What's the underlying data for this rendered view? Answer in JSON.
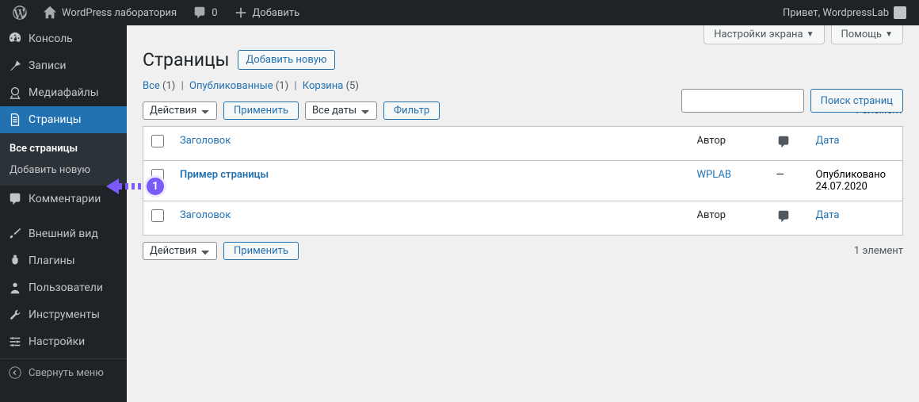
{
  "adminbar": {
    "site_name": "WordPress лаборатория",
    "comments_count": "0",
    "add_new": "Добавить",
    "greeting": "Привет, WordpressLab"
  },
  "sidebar": {
    "items": [
      {
        "label": "Консоль"
      },
      {
        "label": "Записи"
      },
      {
        "label": "Медиафайлы"
      },
      {
        "label": "Страницы"
      },
      {
        "label": "Комментарии"
      },
      {
        "label": "Внешний вид"
      },
      {
        "label": "Плагины"
      },
      {
        "label": "Пользователи"
      },
      {
        "label": "Инструменты"
      },
      {
        "label": "Настройки"
      }
    ],
    "submenu": [
      {
        "label": "Все страницы"
      },
      {
        "label": "Добавить новую"
      }
    ],
    "collapse": "Свернуть меню"
  },
  "screen_options": {
    "settings": "Настройки экрана",
    "help": "Помощь"
  },
  "header": {
    "title": "Страницы",
    "add_new": "Добавить новую"
  },
  "filters": {
    "all_label": "Все",
    "all_count": "(1)",
    "published_label": "Опубликованные",
    "published_count": "(1)",
    "trash_label": "Корзина",
    "trash_count": "(5)"
  },
  "bulk": {
    "actions": "Действия",
    "apply": "Применить",
    "all_dates": "Все даты",
    "filter": "Фильтр"
  },
  "search": {
    "button": "Поиск страниц"
  },
  "count_text": "1 элемент",
  "table": {
    "col_title": "Заголовок",
    "col_author": "Автор",
    "col_date": "Дата",
    "rows": [
      {
        "title": "Пример страницы",
        "author": "WPLAB",
        "comments": "—",
        "date_status": "Опубликовано",
        "date": "24.07.2020"
      }
    ]
  },
  "annotation": {
    "badge": "1"
  }
}
